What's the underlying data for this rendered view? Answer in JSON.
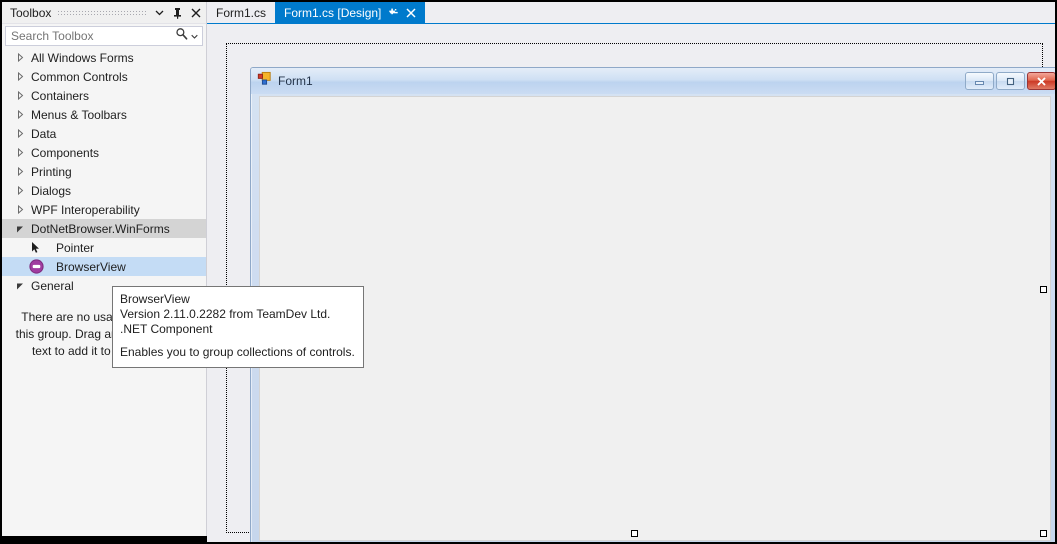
{
  "toolbox": {
    "title": "Toolbox",
    "header_buttons": [
      {
        "name": "dropdown",
        "label": "▼"
      },
      {
        "name": "pin",
        "label": "pin"
      },
      {
        "name": "close",
        "label": "✕"
      }
    ],
    "search": {
      "placeholder": "Search Toolbox",
      "value": "",
      "icon": "search-icon",
      "dropdown_icon": "chevron-down-icon"
    },
    "tree": [
      {
        "label": "All Windows Forms",
        "state": "collapsed",
        "type": "group"
      },
      {
        "label": "Common Controls",
        "state": "collapsed",
        "type": "group"
      },
      {
        "label": "Containers",
        "state": "collapsed",
        "type": "group"
      },
      {
        "label": "Menus & Toolbars",
        "state": "collapsed",
        "type": "group"
      },
      {
        "label": "Data",
        "state": "collapsed",
        "type": "group"
      },
      {
        "label": "Components",
        "state": "collapsed",
        "type": "group"
      },
      {
        "label": "Printing",
        "state": "collapsed",
        "type": "group"
      },
      {
        "label": "Dialogs",
        "state": "collapsed",
        "type": "group"
      },
      {
        "label": "WPF Interoperability",
        "state": "collapsed",
        "type": "group"
      },
      {
        "label": "DotNetBrowser.WinForms",
        "state": "expanded",
        "type": "group",
        "selected": true
      },
      {
        "label": "Pointer",
        "type": "item",
        "icon": "pointer-icon"
      },
      {
        "label": "BrowserView",
        "type": "item",
        "icon": "browserview-icon",
        "highlighted": true
      },
      {
        "label": "General",
        "state": "expanded",
        "type": "group"
      }
    ],
    "empty_group_note": "There are no usable controls in this group. Drag an item onto this text to add it to the toolbox."
  },
  "tabs": [
    {
      "label": "Form1.cs",
      "active": false,
      "closable": false,
      "pinnable": false
    },
    {
      "label": "Form1.cs [Design]",
      "active": true,
      "closable": true,
      "pinnable": true,
      "pin_icon": "pin-icon",
      "close_icon": "close-icon"
    }
  ],
  "designer": {
    "form": {
      "title": "Form1",
      "icon": "form-icon",
      "window_buttons": [
        {
          "name": "minimize-button",
          "glyph": "minimize-icon"
        },
        {
          "name": "maximize-button",
          "glyph": "maximize-icon"
        },
        {
          "name": "close-button",
          "glyph": "close-icon"
        }
      ]
    }
  },
  "tooltip": {
    "name": "BrowserView",
    "version": "Version 2.11.0.2282 from TeamDev Ltd.",
    "kind": ".NET Component",
    "description": "Enables you to group collections of controls."
  },
  "colors": {
    "accent": "#007acc",
    "selection": "#c4dcf5",
    "group_selected": "#d4d4d4",
    "panel_bg": "#f5f5f5",
    "designer_bg": "#eeeef2",
    "browserview_icon": "#a03ca0",
    "close_red": "#cc3a26"
  }
}
